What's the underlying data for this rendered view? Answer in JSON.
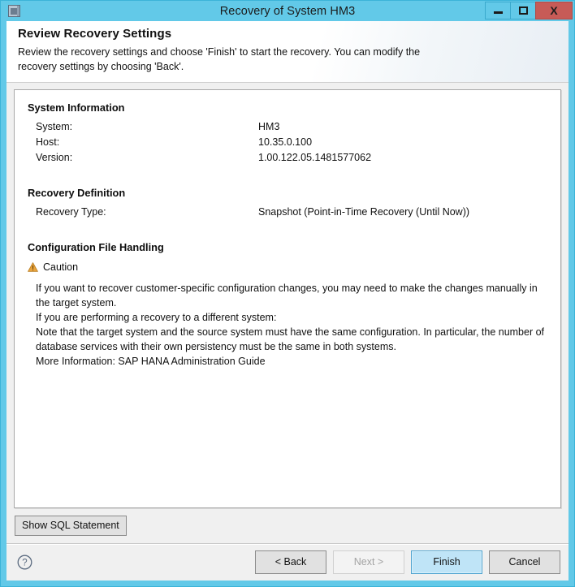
{
  "window": {
    "title": "Recovery of System HM3",
    "app_icon": "window-app-icon",
    "controls": {
      "minimize": "minimize-icon",
      "maximize": "maximize-icon",
      "close": "X"
    }
  },
  "wizard": {
    "title": "Review Recovery Settings",
    "description": "Review the recovery settings and choose 'Finish' to start the recovery. You can modify the recovery settings by choosing 'Back'."
  },
  "sections": {
    "system_information": {
      "heading": "System Information",
      "rows": [
        {
          "key": "System:",
          "value": "HM3"
        },
        {
          "key": "Host:",
          "value": "10.35.0.100"
        },
        {
          "key": "Version:",
          "value": "1.00.122.05.1481577062"
        }
      ]
    },
    "recovery_definition": {
      "heading": "Recovery Definition",
      "rows": [
        {
          "key": "Recovery Type:",
          "value": "Snapshot (Point-in-Time Recovery (Until Now))"
        }
      ]
    },
    "configuration_file_handling": {
      "heading": "Configuration File Handling",
      "caution_label": "Caution",
      "caution_icon": "warning-triangle-icon",
      "lines": [
        "If you want to recover customer-specific configuration changes, you may need to make the changes manually in the target system.",
        "If you are performing a recovery to a different system:",
        "Note that the target system and the source system must have the same configuration. In particular, the number of database services with their own persistency must be the same in both systems.",
        "More Information: SAP HANA Administration Guide"
      ]
    }
  },
  "actions": {
    "show_sql": "Show SQL Statement",
    "help_icon": "help-question-icon",
    "back": "< Back",
    "next": "Next >",
    "finish": "Finish",
    "cancel": "Cancel"
  },
  "colors": {
    "titlebar": "#62c9e8",
    "close_button": "#c75b57",
    "dialog_background": "#f0f0f0",
    "panel_background": "#ffffff",
    "primary_button": "#bfe4f7",
    "caution_icon": "#e8a33d"
  }
}
